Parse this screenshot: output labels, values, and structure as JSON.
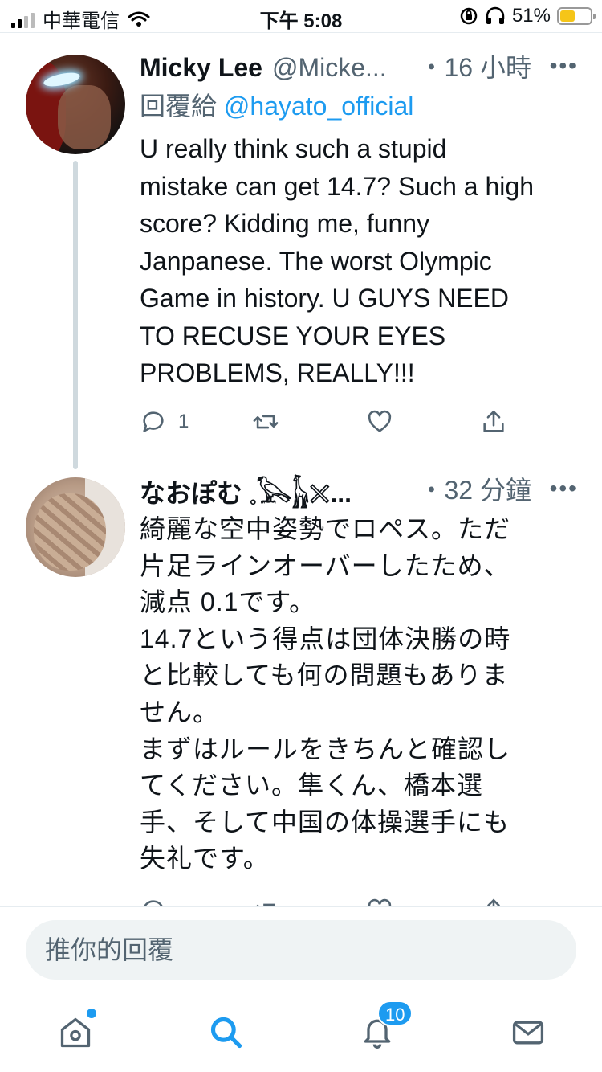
{
  "status_bar": {
    "carrier": "中華電信",
    "time": "下午 5:08",
    "battery": "51%",
    "battery_level": 0.51,
    "battery_color": "#f5c518"
  },
  "tweets": [
    {
      "name": "Micky Lee",
      "handle": "@Micke...",
      "time": "・16 小時",
      "reply_prefix": "回覆給",
      "reply_mention": "@hayato_official",
      "text": "U really think such a stupid\nmistake can get 14.7? Such a high\nscore? Kidding me, funny\nJanpanese. The worst Olympic\nGame in history. U GUYS NEED\nTO RECUSE YOUR EYES\nPROBLEMS, REALLY!!!",
      "reply_count": "1"
    },
    {
      "name": "なおぽむ 𓈒𓅂𓃱𓏴...",
      "time": "・32 分鐘",
      "text": "綺麗な空中姿勢でロペス。ただ\n片足ラインオーバーしたため、\n減点 0.1です。\n14.7という得点は団体決勝の時\nと比較しても何の問題もありま\nせん。\nまずはルールをきちんと確認し\nてください。隼くん、橋本選\n手、そして中国の体操選手にも\n失礼です。"
    }
  ],
  "reply_bar": {
    "placeholder": "推你的回覆"
  },
  "tab_bar": {
    "notifications_badge": "10",
    "accent_color": "#1d9bf0"
  },
  "icons": {
    "more": "more-horizontal-icon",
    "reply": "reply-icon",
    "retweet": "retweet-icon",
    "like": "heart-icon",
    "share": "share-icon"
  }
}
